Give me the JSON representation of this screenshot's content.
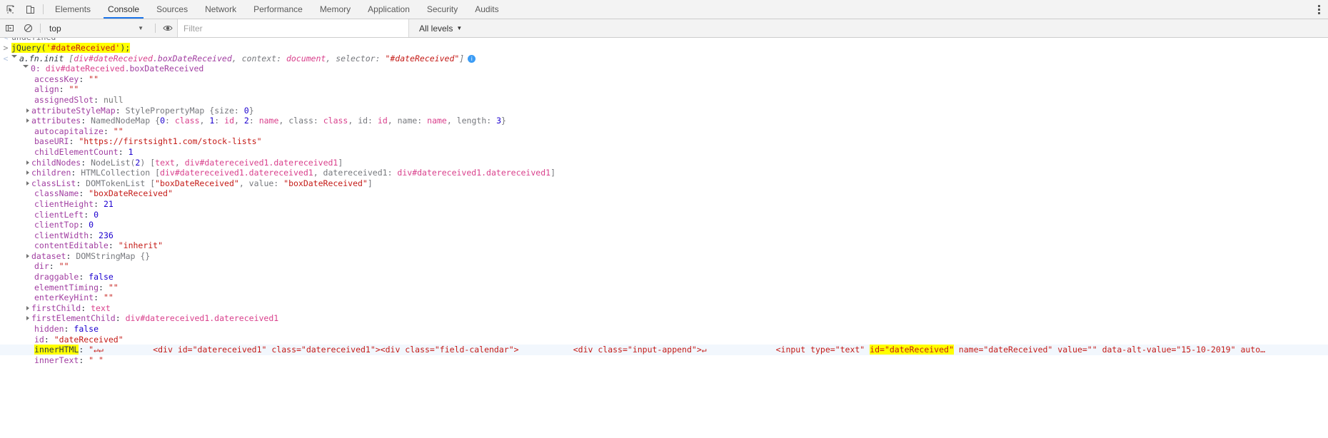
{
  "window": {
    "app": "Chrome DevTools",
    "panel": "Console"
  },
  "tabbar": {
    "inspect_icon": "inspect-cursor-icon",
    "device_icon": "device-toolbar-icon",
    "tabs": [
      {
        "label": "Elements",
        "active": false
      },
      {
        "label": "Console",
        "active": true
      },
      {
        "label": "Sources",
        "active": false
      },
      {
        "label": "Network",
        "active": false
      },
      {
        "label": "Performance",
        "active": false
      },
      {
        "label": "Memory",
        "active": false
      },
      {
        "label": "Application",
        "active": false
      },
      {
        "label": "Security",
        "active": false
      },
      {
        "label": "Audits",
        "active": false
      }
    ],
    "more_icon": "kebab-menu-icon"
  },
  "consolebar": {
    "execute_icon": "execute-sidebar-icon",
    "clear_icon": "clear-console-icon",
    "context": "top",
    "context_caret": "▼",
    "eye_icon": "live-expression-eye-icon",
    "filter_value": "",
    "filter_placeholder": "Filter",
    "levels_label": "All levels",
    "levels_caret": "▼"
  },
  "console": {
    "scrolled_partial_line": {
      "gutter": "<",
      "text": "undefined"
    },
    "input_line": {
      "gutter": ">",
      "code": "jQuery('#dateReceived');",
      "code_plain_1": "jQuery(",
      "code_string": "'#dateReceived'",
      "code_plain_2": ");",
      "highlighted": true
    },
    "result_line": {
      "gutter": "<",
      "constructor": "a.fn.init",
      "bracket_open": "[",
      "node": "div#dateReceived",
      "node_class": ".boxDateReceived",
      "ctx_key": "context:",
      "ctx_val": "document",
      "sel_key": "selector:",
      "sel_val": "\"#dateReceived\"",
      "bracket_close": "]",
      "info_icon": "info-circle-icon"
    },
    "zero_line": {
      "key": "0:",
      "node": "div#dateReceived",
      "node_class": ".boxDateReceived"
    },
    "properties": [
      {
        "expandable": false,
        "name": "accessKey",
        "value": "\"\"",
        "type": "string"
      },
      {
        "expandable": false,
        "name": "align",
        "value": "\"\"",
        "type": "string"
      },
      {
        "expandable": false,
        "name": "assignedSlot",
        "value": "null",
        "type": "null"
      },
      {
        "expandable": true,
        "name": "attributeStyleMap",
        "value": "StylePropertyMap {size: 0}",
        "type": "object-size"
      },
      {
        "expandable": true,
        "name": "attributes",
        "value": "NamedNodeMap {0: class, 1: id, 2: name, class: class, id: id, name: name, length: 3}",
        "type": "namedmap"
      },
      {
        "expandable": false,
        "name": "autocapitalize",
        "value": "\"\"",
        "type": "string"
      },
      {
        "expandable": false,
        "name": "baseURI",
        "value": "\"https://firstsight1.com/stock-lists\"",
        "type": "string"
      },
      {
        "expandable": false,
        "name": "childElementCount",
        "value": "1",
        "type": "number"
      },
      {
        "expandable": true,
        "name": "childNodes",
        "value": "NodeList(2) [text, div#datereceived1.datereceived1]",
        "type": "nodelist"
      },
      {
        "expandable": true,
        "name": "children",
        "value": "HTMLCollection [div#datereceived1.datereceived1, datereceived1: div#datereceived1.datereceived1]",
        "type": "htmlcollection"
      },
      {
        "expandable": true,
        "name": "classList",
        "value": "DOMTokenList [\"boxDateReceived\", value: \"boxDateReceived\"]",
        "type": "tokenlist"
      },
      {
        "expandable": false,
        "name": "className",
        "value": "\"boxDateReceived\"",
        "type": "string"
      },
      {
        "expandable": false,
        "name": "clientHeight",
        "value": "21",
        "type": "number"
      },
      {
        "expandable": false,
        "name": "clientLeft",
        "value": "0",
        "type": "number"
      },
      {
        "expandable": false,
        "name": "clientTop",
        "value": "0",
        "type": "number"
      },
      {
        "expandable": false,
        "name": "clientWidth",
        "value": "236",
        "type": "number"
      },
      {
        "expandable": false,
        "name": "contentEditable",
        "value": "\"inherit\"",
        "type": "string"
      },
      {
        "expandable": true,
        "name": "dataset",
        "value": "DOMStringMap {}",
        "type": "object-empty"
      },
      {
        "expandable": false,
        "name": "dir",
        "value": "\"\"",
        "type": "string"
      },
      {
        "expandable": false,
        "name": "draggable",
        "value": "false",
        "type": "boolean"
      },
      {
        "expandable": false,
        "name": "elementTiming",
        "value": "\"\"",
        "type": "string"
      },
      {
        "expandable": false,
        "name": "enterKeyHint",
        "value": "\"\"",
        "type": "string"
      },
      {
        "expandable": true,
        "name": "firstChild",
        "value": "text",
        "type": "node"
      },
      {
        "expandable": true,
        "name": "firstElementChild",
        "value": "div#datereceived1.datereceived1",
        "type": "node"
      },
      {
        "expandable": false,
        "name": "hidden",
        "value": "false",
        "type": "boolean"
      },
      {
        "expandable": false,
        "name": "id",
        "value": "\"dateReceived\"",
        "type": "string"
      }
    ],
    "innerhtml_row": {
      "name": "innerHTML",
      "prefix": "\"↵↵",
      "seg_div_open": "<div id=\"datereceived1\" class=\"datereceived1\"><div class=\"field-calendar\">",
      "seg_append": "<div class=\"input-append\">↵",
      "seg_input": "<input type=\"text\" ",
      "seg_highlight": "id=\"dateReceived\"",
      "seg_tail": " name=\"dateReceived\" value=\"\" data-alt-value=\"15-10-2019\" auto…",
      "highlighted_name": true
    },
    "innertext_row": {
      "name": "innerText",
      "value": "\" \""
    }
  }
}
